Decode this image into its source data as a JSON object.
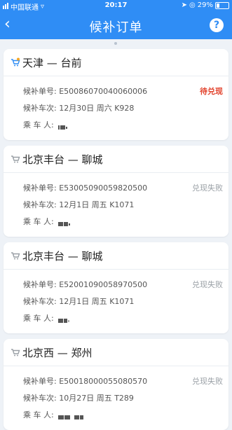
{
  "status_bar": {
    "carrier": "中国联通",
    "time": "20:17",
    "battery": "29%"
  },
  "nav": {
    "title": "候补订单",
    "help_label": "?"
  },
  "labels": {
    "order_no": "候补单号:",
    "train": "候补车次:",
    "passenger": "乘 车 人:"
  },
  "orders": [
    {
      "route": "天津 — 台前",
      "order_no": "E500860700400600​06",
      "train": "12月30日 周六 K928",
      "status": "待兑现",
      "status_type": "pending"
    },
    {
      "route": "北京丰台 — 聊城",
      "order_no": "E530050900598205​00",
      "train": "12月1日 周五 K1071",
      "status": "兑现失败",
      "status_type": "failed"
    },
    {
      "route": "北京丰台 — 聊城",
      "order_no": "E520010900589705​00",
      "train": "12月1日 周五 K1071",
      "status": "兑现失败",
      "status_type": "failed"
    },
    {
      "route": "北京西 — 郑州",
      "order_no": "E500180000550805​70",
      "train": "10月27日 周五 T289",
      "status": "兑现失败",
      "status_type": "failed"
    }
  ],
  "colors": {
    "primary": "#2f8df5",
    "pending": "#e2442e",
    "failed": "#9aa0a6"
  }
}
